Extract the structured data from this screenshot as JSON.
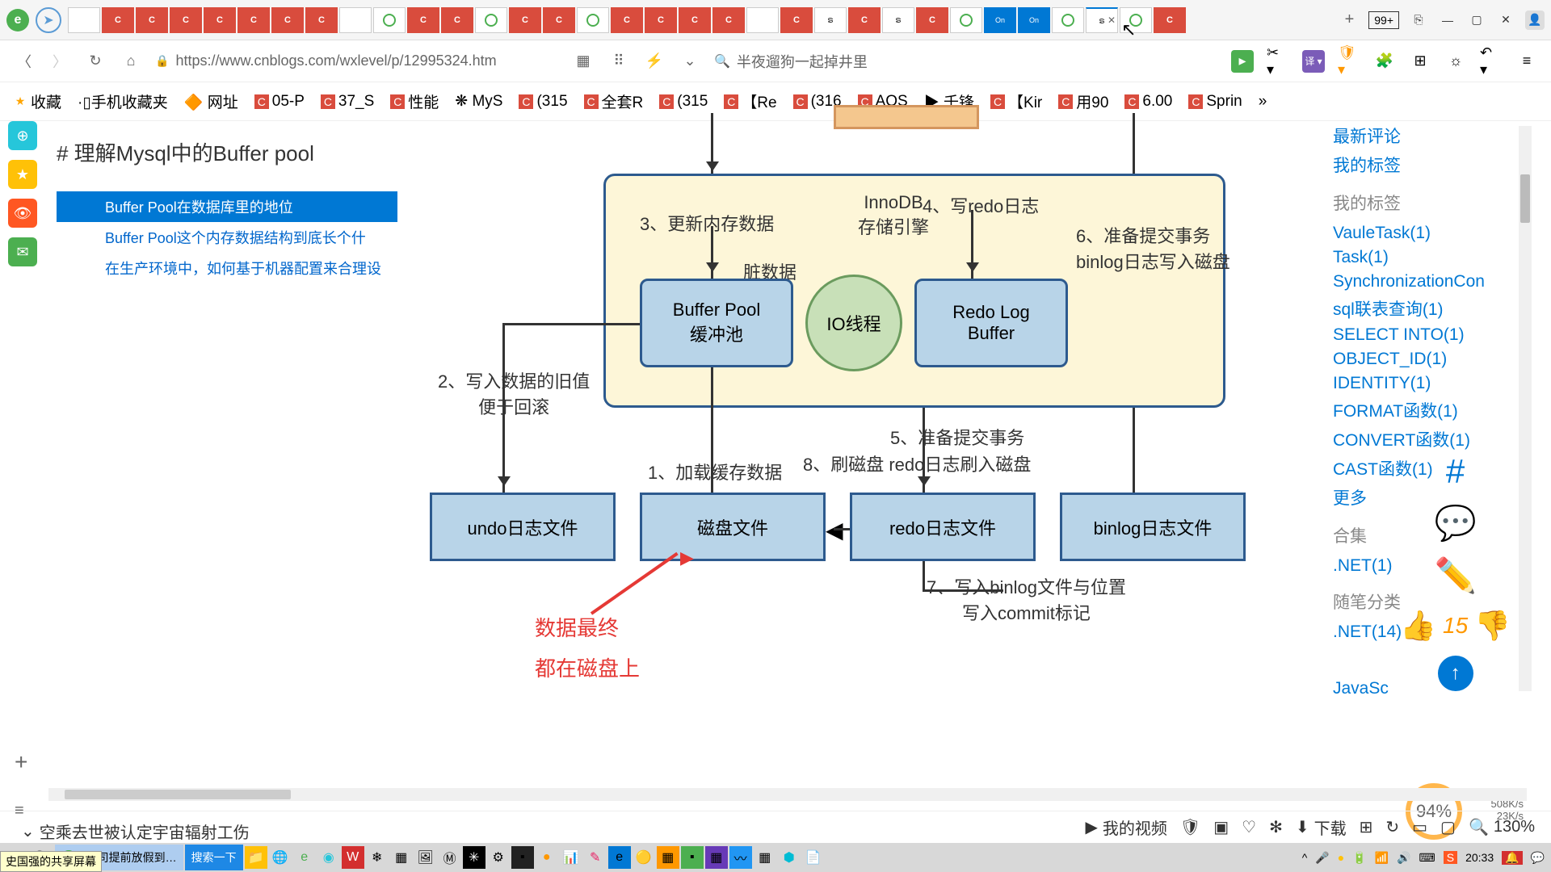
{
  "titlebar": {
    "badge": "99+",
    "tabs": [
      {
        "t": "b"
      },
      {
        "t": "c"
      },
      {
        "t": "c"
      },
      {
        "t": "c"
      },
      {
        "t": "c"
      },
      {
        "t": "c"
      },
      {
        "t": "c"
      },
      {
        "t": "c"
      },
      {
        "t": "b"
      },
      {
        "t": "o"
      },
      {
        "t": "c"
      },
      {
        "t": "c"
      },
      {
        "t": "o"
      },
      {
        "t": "c"
      },
      {
        "t": "c"
      },
      {
        "t": "o"
      },
      {
        "t": "c"
      },
      {
        "t": "c"
      },
      {
        "t": "c"
      },
      {
        "t": "c"
      },
      {
        "t": "b"
      },
      {
        "t": "c"
      },
      {
        "t": "sw"
      },
      {
        "t": "c"
      },
      {
        "t": "sw"
      },
      {
        "t": "c"
      },
      {
        "t": "o"
      },
      {
        "t": "on",
        "l": "On"
      },
      {
        "t": "on",
        "l": "On"
      },
      {
        "t": "o"
      },
      {
        "t": "sw",
        "active": true
      },
      {
        "t": "o"
      },
      {
        "t": "c"
      }
    ]
  },
  "addrbar": {
    "url": "https://www.cnblogs.com/wxlevel/p/12995324.htm",
    "search_placeholder": "半夜遛狗一起掉井里"
  },
  "bookmarks": [
    {
      "icon": "star",
      "label": "收藏"
    },
    {
      "icon": "",
      "label": "·▯手机收藏夹"
    },
    {
      "icon": "",
      "label": "🔶 网址"
    },
    {
      "icon": "c",
      "label": "05-P"
    },
    {
      "icon": "c",
      "label": "37_S"
    },
    {
      "icon": "c",
      "label": "性能"
    },
    {
      "icon": "",
      "label": "❋ MyS"
    },
    {
      "icon": "c",
      "label": "(315"
    },
    {
      "icon": "c",
      "label": "全套R"
    },
    {
      "icon": "c",
      "label": "(315"
    },
    {
      "icon": "c",
      "label": "【Re"
    },
    {
      "icon": "c",
      "label": "(316"
    },
    {
      "icon": "c",
      "label": "AQS"
    },
    {
      "icon": "",
      "label": "▶ 千锋"
    },
    {
      "icon": "c",
      "label": "【Kir"
    },
    {
      "icon": "c",
      "label": "用90"
    },
    {
      "icon": "c",
      "label": "6.00"
    },
    {
      "icon": "c",
      "label": "Sprin"
    }
  ],
  "article": {
    "title": "# 理解Mysql中的Buffer pool",
    "outline": [
      {
        "text": "Buffer Pool在数据库里的地位",
        "active": true
      },
      {
        "text": "Buffer Pool这个内存数据结构到底长个什"
      },
      {
        "text": "在生产环境中，如何基于机器配置来合理设"
      }
    ]
  },
  "diagram": {
    "labels": {
      "l3": "3、更新内存数据",
      "l4": "4、写redo日志",
      "innodb": "InnoDB\n存储引擎",
      "dirty": "脏数据",
      "bufpool": "Buffer Pool\n缓冲池",
      "iothread": "IO线程",
      "redolog": "Redo Log\nBuffer",
      "l6": "6、准备提交事务\nbinlog日志写入磁盘",
      "l2": "2、写入数据的旧值\n便于回滚",
      "l1": "1、加载缓存数据",
      "l5": "5、准备提交事务",
      "l8": "8、刷磁盘 redo日志刷入磁盘",
      "undo": "undo日志文件",
      "disk": "磁盘文件",
      "redo": "redo日志文件",
      "binlog": "binlog日志文件",
      "l7": "7、写入binlog文件与位置\n写入commit标记",
      "red1": "数据最终",
      "red2": "都在磁盘上"
    }
  },
  "rightbar": {
    "top_links": [
      "最新评论",
      "我的标签"
    ],
    "sec1_title": "我的标签",
    "sec1_links": [
      "VauleTask(1)",
      "Task(1)",
      "SynchronizationCon",
      "sql联表查询(1)",
      "SELECT INTO(1)",
      "OBJECT_ID(1)",
      "IDENTITY(1)",
      "FORMAT函数(1)",
      "CONVERT函数(1)",
      "CAST函数(1)",
      "更多"
    ],
    "sec2_title": "合集",
    "sec2_links": [
      ".NET(1)"
    ],
    "sec3_title": "随笔分类",
    "sec3_links": [
      ".NET(14)"
    ],
    "javasc": "JavaSc",
    "like_count": "15",
    "progress": "94%"
  },
  "netspeed": {
    "up": "508K/s",
    "down": "23K/s"
  },
  "statusbar": {
    "news": "空乘去世被认定宇宙辐射工伤",
    "video": "我的视频",
    "download": "下载",
    "zoom": "130%"
  },
  "taskbar": {
    "item1": "公司提前放假到…",
    "search": "搜索一下",
    "time": "20:33",
    "overlay": "史国强的共享屏幕"
  }
}
